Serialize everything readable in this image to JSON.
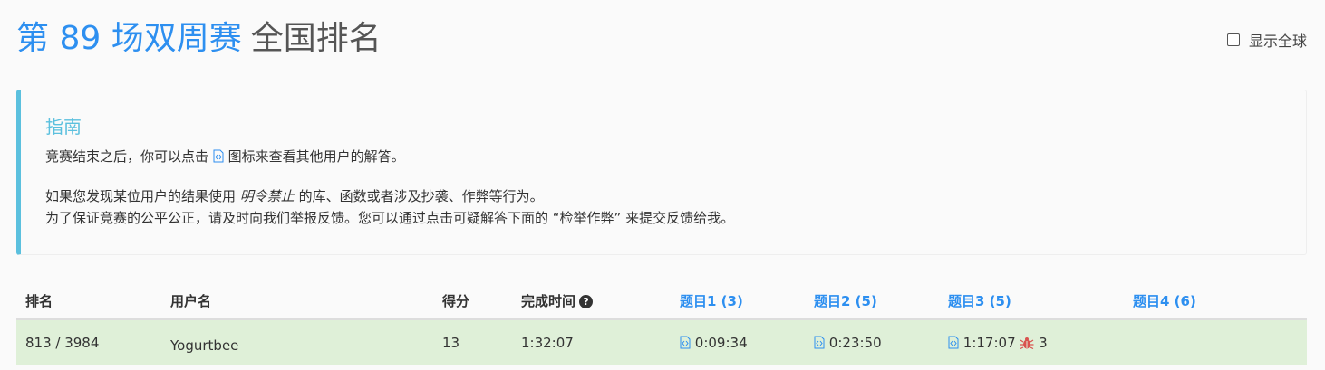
{
  "header": {
    "contest_title": "第 89 场双周赛",
    "title_suffix": "全国排名"
  },
  "global_toggle": {
    "label": "显示全球",
    "checked": false
  },
  "guide": {
    "title": "指南",
    "line1_before": "竞赛结束之后，你可以点击",
    "line1_after": "图标来查看其他用户的解答。",
    "line2_before": "如果您发现某位用户的结果使用",
    "line2_emphasis": "明令禁止",
    "line2_after": "的库、函数或者涉及抄袭、作弊等行为。",
    "line3": "为了保证竞赛的公平公正，请及时向我们举报反馈。您可以通过点击可疑解答下面的 “检举作弊” 来提交反馈给我。"
  },
  "table": {
    "headers": {
      "rank": "排名",
      "username": "用户名",
      "score": "得分",
      "finish_time": "完成时间",
      "q1": "题目1 (3)",
      "q2": "题目2 (5)",
      "q3": "题目3 (5)",
      "q4": "题目4 (6)"
    },
    "row": {
      "rank": "813 / 3984",
      "username": "Yogurtbee",
      "score": "13",
      "finish_time": "1:32:07",
      "q1_time": "0:09:34",
      "q2_time": "0:23:50",
      "q3_time": "1:17:07",
      "q3_wrong_attempts": "3"
    }
  },
  "colors": {
    "accent_blue": "#2d8ff0",
    "guide_border": "#5bc0de",
    "row_highlight": "#dff0d8",
    "bug_red": "#d9534f"
  },
  "icons": {
    "solution": "code-file-icon",
    "help": "question-circle-icon",
    "wrong_attempt": "bug-icon"
  }
}
